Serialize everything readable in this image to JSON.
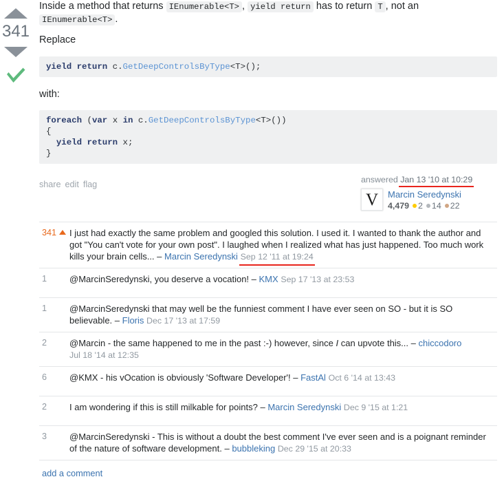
{
  "vote": {
    "score": "341",
    "upvote_name": "upvote-arrow",
    "downvote_name": "downvote-arrow",
    "accepted": true
  },
  "post": {
    "intro": {
      "before_code1": "Inside a method that returns",
      "code1": "IEnumerable<T>",
      "comma1": ",",
      "code2": "yield return",
      "middle": "has to return",
      "code3": "T",
      "after": ", not an",
      "code4": "IEnumerable<T>",
      "period": "."
    },
    "replace_label": "Replace",
    "code_block_1": "yield return c.GetDeepControlsByType<T>();",
    "code_block_1_tokens": {
      "kw": "yield return",
      "plain_pre": " c.",
      "typ": "GetDeepControlsByType",
      "plain_post": "<T>();"
    },
    "with_label": "with:",
    "code_block_2_lines": [
      "foreach (var x in c.GetDeepControlsByType<T>())",
      "{",
      "  yield return x;",
      "}"
    ],
    "menu": [
      "share",
      "edit",
      "flag"
    ]
  },
  "signature": {
    "action": "answered",
    "timestamp": "Jan 13 '10 at 10:29",
    "avatar_letter": "V",
    "username": "Marcin Seredynski",
    "reputation": "4,479",
    "gold": "2",
    "silver": "14",
    "bronze": "22"
  },
  "comments": [
    {
      "score": "341",
      "has_upvote_arrow": true,
      "text": "I just had exactly the same problem and googled this solution. I used it. I wanted to thank the author and got \"You can't vote for your own post\". I laughed when I realized what has just happened. Too much work kills your brain cells...",
      "dash": " – ",
      "user": "Marcin Seredynski",
      "date": "Sep 12 '11 at 19:24",
      "underlined": true
    },
    {
      "score": "1",
      "has_upvote_arrow": false,
      "text": "@MarcinSeredynski, you deserve a vocation!",
      "dash": " – ",
      "user": "KMX",
      "date": "Sep 17 '13 at 23:53",
      "underlined": false
    },
    {
      "score": "1",
      "has_upvote_arrow": false,
      "text": "@MarcinSeredynski that may well be the funniest comment I have ever seen on SO - but it is SO believable.",
      "dash": " – ",
      "user": "Floris",
      "date": "Dec 17 '13 at 17:59",
      "underlined": false
    },
    {
      "score": "2",
      "has_upvote_arrow": false,
      "text_pre": "@Marcin - the same happened to me in the past :-) however, since ",
      "text_italic": "I",
      "text_post": " can upvote this...",
      "dash": " – ",
      "user": "chiccodoro",
      "date": "Jul 18 '14 at 12:35",
      "underlined": false
    },
    {
      "score": "6",
      "has_upvote_arrow": false,
      "text": "@KMX - his vOcation is obviously 'Software Developer'!",
      "dash": " – ",
      "user": "FastAl",
      "date": "Oct 6 '14 at 13:43",
      "underlined": false
    },
    {
      "score": "2",
      "has_upvote_arrow": false,
      "text": "I am wondering if this is still milkable for points?",
      "dash": " – ",
      "user": "Marcin Seredynski",
      "date": "Dec 9 '15 at 1:21",
      "underlined": false
    },
    {
      "score": "3",
      "has_upvote_arrow": false,
      "text": "@MarcinSeredynski - This is without a doubt the best comment I've ever seen and is a poignant reminder of the nature of software development.",
      "dash": " – ",
      "user": "bubbleking",
      "date": "Dec 29 '15 at 20:33",
      "underlined": false
    }
  ],
  "add_comment_label": "add a comment",
  "colors": {
    "accent_link": "#3b73af",
    "hot_orange": "#e8691d",
    "annotation_red": "#e8241c",
    "accepted_green": "#5eba7d",
    "code_bg": "#eff0f1",
    "gold": "#ffcc01",
    "silver": "#b4b8bc",
    "bronze": "#d1a684"
  }
}
